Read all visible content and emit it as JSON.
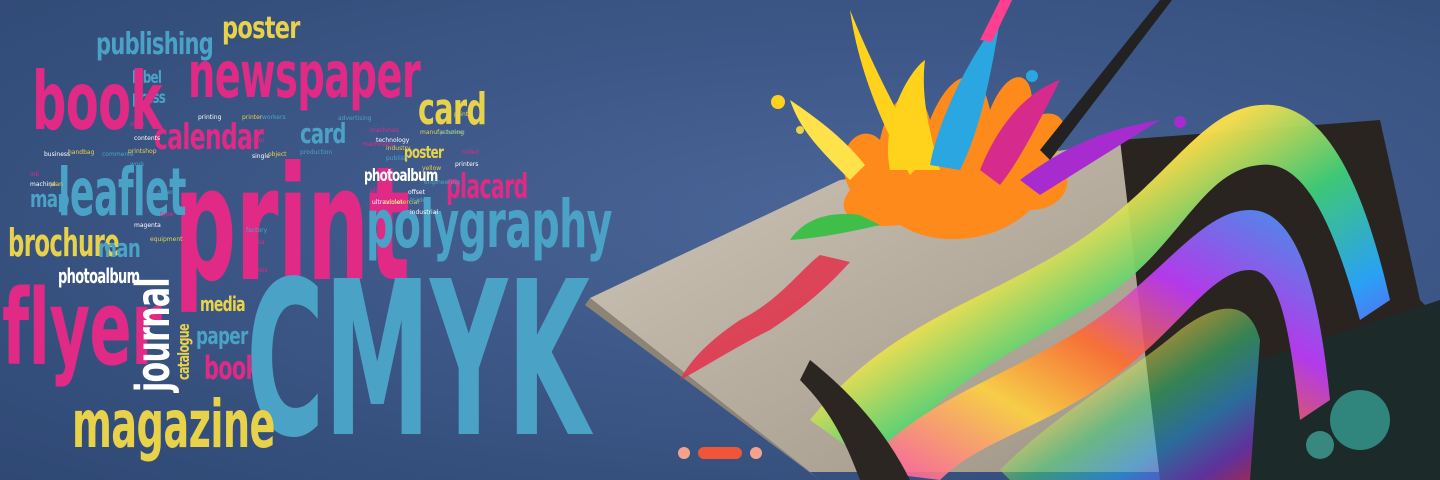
{
  "slider": {
    "word_cloud": [
      {
        "text": "publishing",
        "color": "#4aa3c6"
      },
      {
        "text": "poster",
        "color": "#e8d24a"
      },
      {
        "text": "label",
        "color": "#4aa3c6"
      },
      {
        "text": "press",
        "color": "#4aa3c6"
      },
      {
        "text": "newspaper",
        "color": "#e02a86"
      },
      {
        "text": "book",
        "color": "#e02a86"
      },
      {
        "text": "card",
        "color": "#e8d24a"
      },
      {
        "text": "calendar",
        "color": "#e02a86"
      },
      {
        "text": "card",
        "color": "#4aa3c6"
      },
      {
        "text": "poster",
        "color": "#e8d24a"
      },
      {
        "text": "print",
        "color": "#e02a86"
      },
      {
        "text": "leaflet",
        "color": "#4aa3c6"
      },
      {
        "text": "map",
        "color": "#4aa3c6"
      },
      {
        "text": "photoalbum",
        "color": "#ffffff"
      },
      {
        "text": "placard",
        "color": "#e02a86"
      },
      {
        "text": "polygraphy",
        "color": "#4aa3c6"
      },
      {
        "text": "brochure",
        "color": "#e8d24a"
      },
      {
        "text": "man",
        "color": "#4aa3c6"
      },
      {
        "text": "photoalbum",
        "color": "#ffffff"
      },
      {
        "text": "flyer",
        "color": "#e02a86"
      },
      {
        "text": "journal",
        "color": "#ffffff"
      },
      {
        "text": "catalogue",
        "color": "#e8d24a"
      },
      {
        "text": "media",
        "color": "#e8d24a"
      },
      {
        "text": "paper",
        "color": "#4aa3c6"
      },
      {
        "text": "book",
        "color": "#e02a86"
      },
      {
        "text": "CMYK",
        "color": "#4aa3c6"
      },
      {
        "text": "magazine",
        "color": "#e8d24a"
      }
    ],
    "tiny_words": [
      "business",
      "handbag",
      "commerce",
      "shop",
      "contents",
      "printshop",
      "work",
      "ink",
      "machine",
      "plan",
      "rollers",
      "type",
      "magenta",
      "equipment",
      "factory",
      "media",
      "printing",
      "printer",
      "workers",
      "color",
      "single",
      "object",
      "production",
      "machines",
      "technology",
      "industry",
      "publish",
      "machinery",
      "offset",
      "manufacturing",
      "pantone",
      "rolled",
      "printers",
      "yellow",
      "engineering",
      "plaid",
      "ultraviolet",
      "commercial",
      "trade",
      "books",
      "industrial",
      "print",
      "advertising"
    ],
    "pagination": {
      "count": 3,
      "active_index": 1
    },
    "colors": {
      "pink": "#e02a86",
      "blue": "#4aa3c6",
      "yellow": "#e8d24a",
      "dot": "#f7a28f",
      "dot_active": "#f0553a"
    },
    "icons": [
      "paint-splash-art",
      "open-book-art"
    ]
  }
}
